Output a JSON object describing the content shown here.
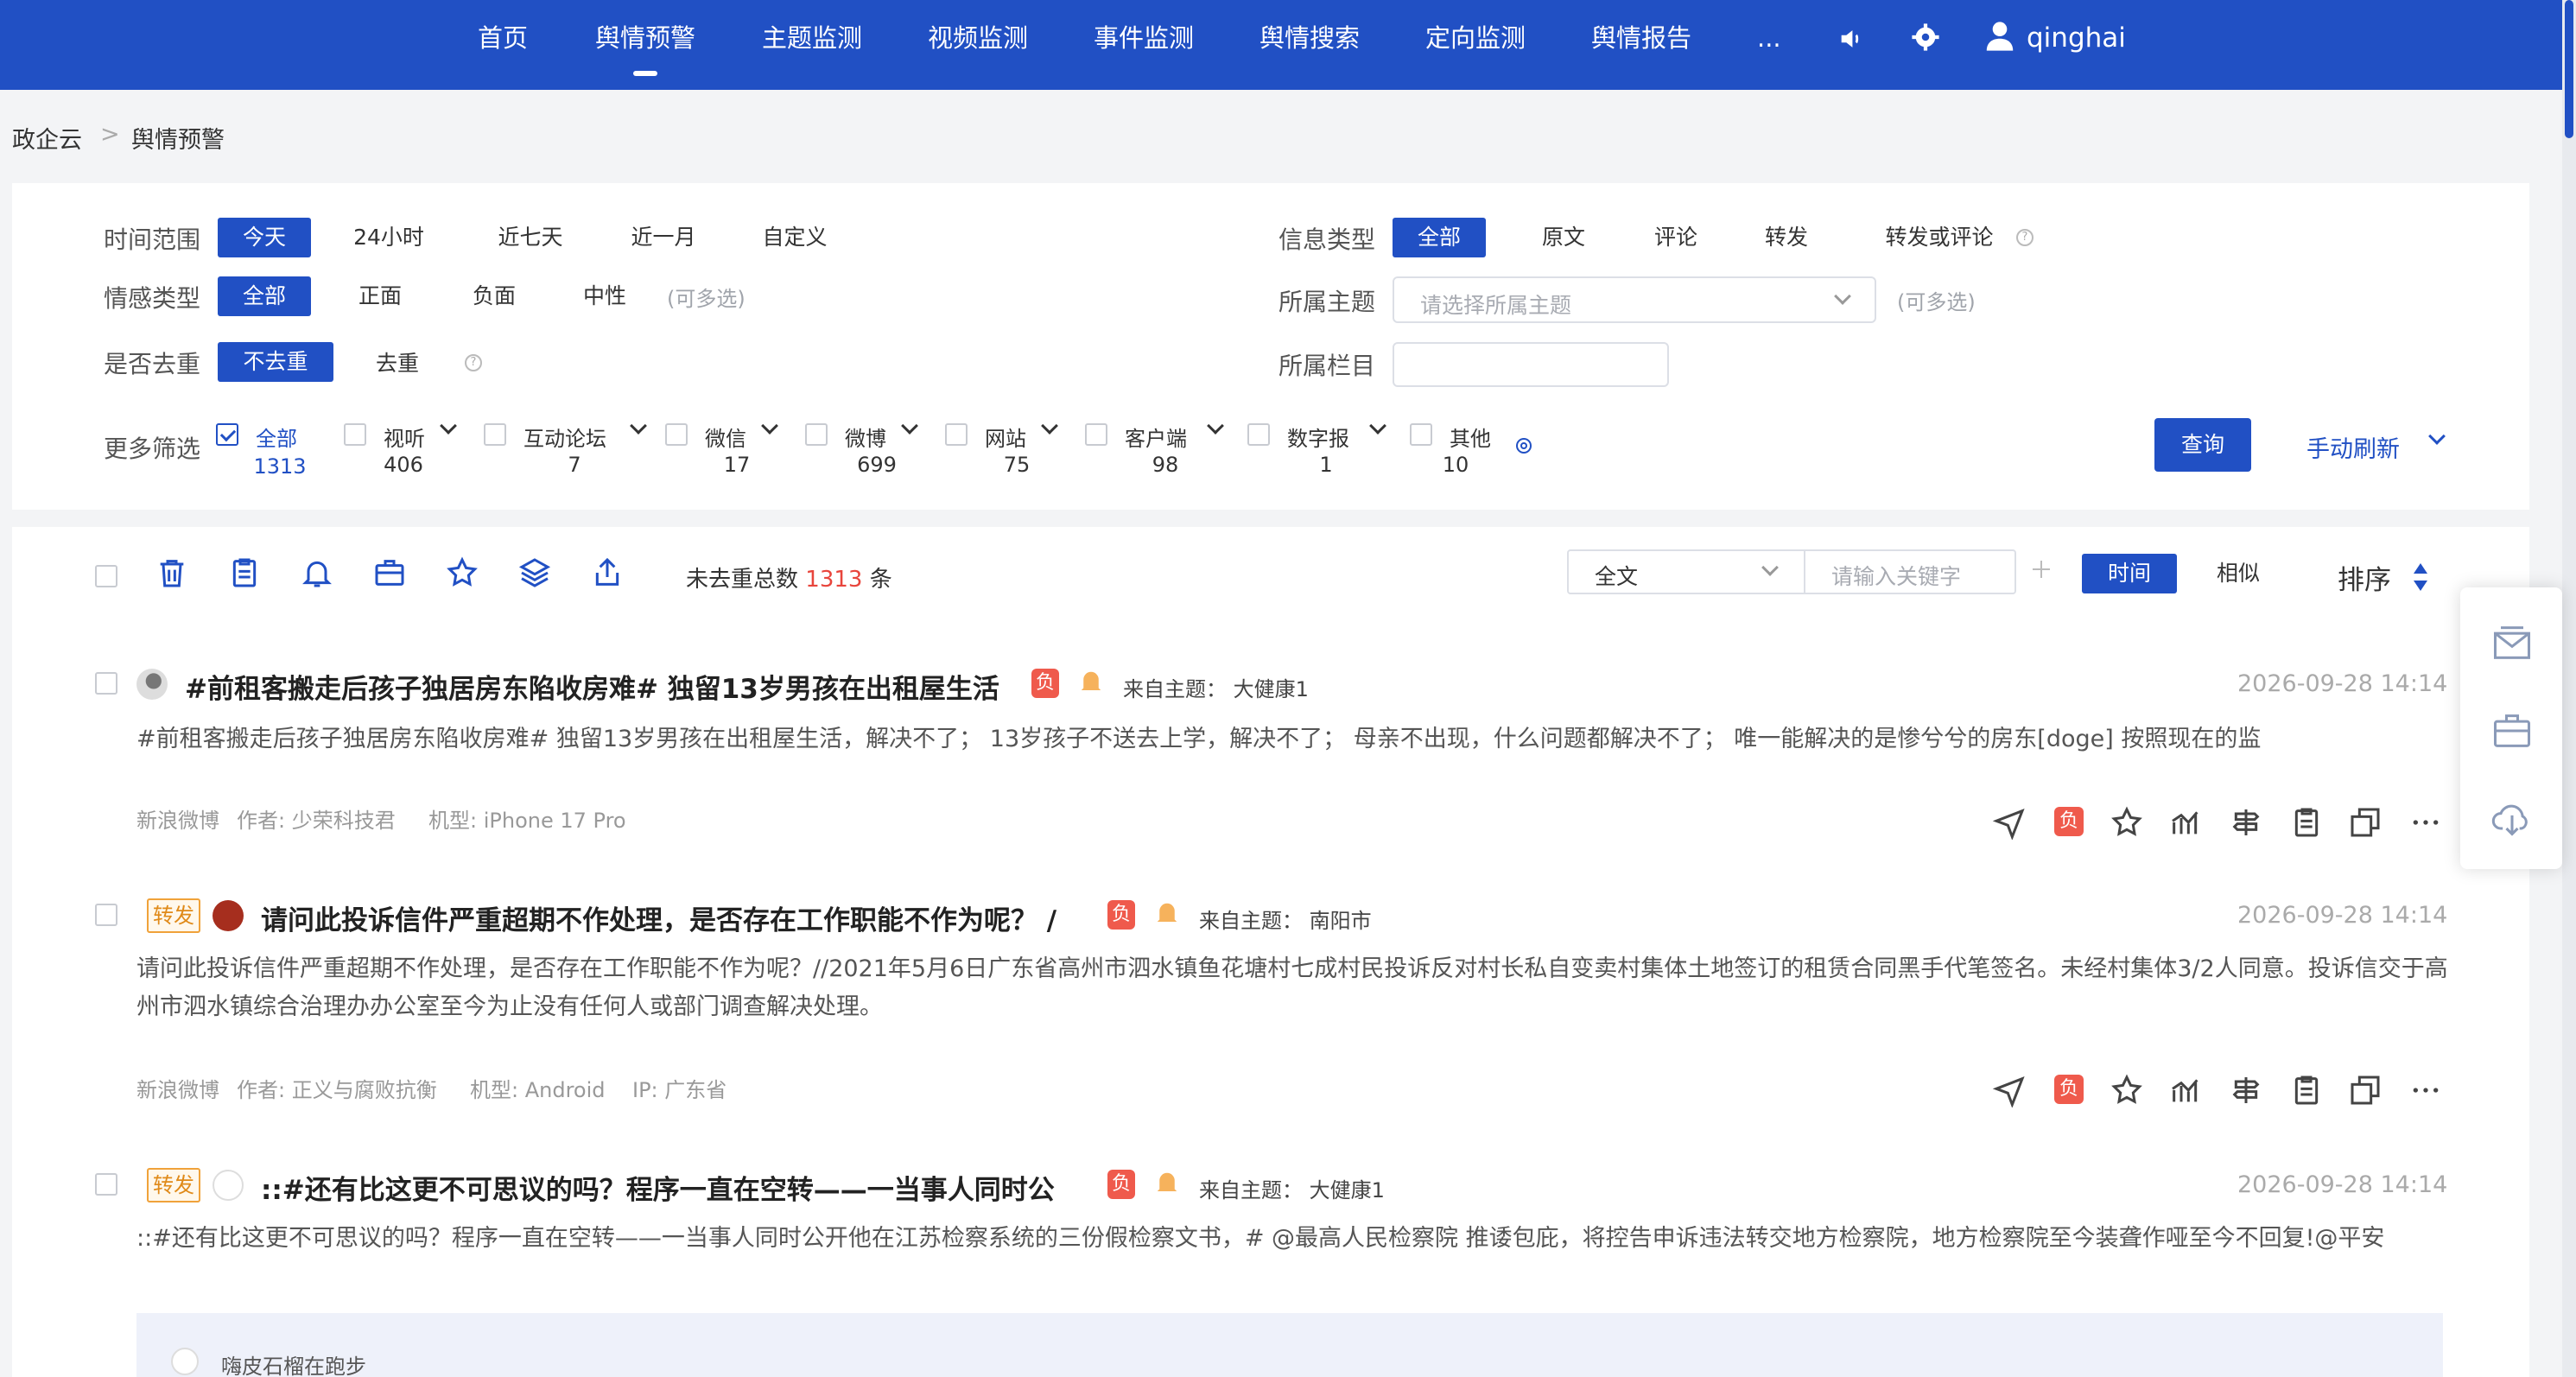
{
  "nav": {
    "items": [
      "首页",
      "舆情预警",
      "主题监测",
      "视频监测",
      "事件监测",
      "舆情搜索",
      "定向监测",
      "舆情报告",
      "..."
    ],
    "active": "舆情预警",
    "user": "qinghai"
  },
  "breadcrumb": {
    "root": "政企云",
    "sep": ">",
    "current": "舆情预警"
  },
  "filters": {
    "time_label": "时间范围",
    "time_opts": [
      "今天",
      "24小时",
      "近七天",
      "近一月",
      "自定义"
    ],
    "sentiment_label": "情感类型",
    "sentiment_opts": [
      "全部",
      "正面",
      "负面",
      "中性"
    ],
    "multi_hint": "(可多选)",
    "dedup_label": "是否去重",
    "dedup_opts": [
      "不去重",
      "去重"
    ],
    "info_label": "信息类型",
    "info_opts": [
      "全部",
      "原文",
      "评论",
      "转发",
      "转发或评论"
    ],
    "topic_label": "所属主题",
    "topic_placeholder": "请选择所属主题",
    "column_label": "所属栏目",
    "more_label": "更多筛选",
    "sources": [
      {
        "name": "全部",
        "count": "1313"
      },
      {
        "name": "视听",
        "count": "406"
      },
      {
        "name": "互动论坛",
        "count": "7"
      },
      {
        "name": "微信",
        "count": "17"
      },
      {
        "name": "微博",
        "count": "699"
      },
      {
        "name": "网站",
        "count": "75"
      },
      {
        "name": "客户端",
        "count": "98"
      },
      {
        "name": "数字报",
        "count": "1"
      },
      {
        "name": "其他",
        "count": "10"
      }
    ],
    "query_btn": "查询",
    "refresh": "手动刷新"
  },
  "toolbar": {
    "total_prefix": "未去重总数",
    "total": "1313",
    "total_suffix": "条",
    "scope": "全文",
    "keyword_placeholder": "请输入关键字",
    "time_btn": "时间",
    "similar_btn": "相似",
    "sort": "排序"
  },
  "posts": [
    {
      "title": "#前租客搬走后孩子独居房东陷收房难# 独留13岁男孩在出租屋生活",
      "neg": "负",
      "topic_label": "来自主题：",
      "topic": "大健康1",
      "date": "2026-09-28 14:14",
      "body": "#前租客搬走后孩子独居房东陷收房难# 独留13岁男孩在出租屋生活，解决不了； 13岁孩子不送去上学，解决不了； 母亲不出现，什么问题都解决不了； 唯一能解决的是惨兮兮的房东[doge] 按照现在的监",
      "meta": [
        "新浪微博",
        "作者: 少荣科技君",
        "机型: iPhone 17 Pro"
      ]
    },
    {
      "tag": "转发",
      "title": "请问此投诉信件严重超期不作处理，是否存在工作职能不作为呢？ /",
      "neg": "负",
      "topic_label": "来自主题：",
      "topic": "南阳市",
      "date": "2026-09-28 14:14",
      "body": "请问此投诉信件严重超期不作处理，是否存在工作职能不作为呢？//2021年5月6日广东省高州市泗水镇鱼花塘村七成村民投诉反对村长私自变卖村集体土地签订的租赁合同黑手代笔签名。未经村集体3/2人同意。投诉信交于高州市泗水镇综合治理办办公室至今为止没有任何人或部门调查解决处理。",
      "meta": [
        "新浪微博",
        "作者: 正义与腐败抗衡",
        "机型: Android",
        "IP: 广东省"
      ]
    },
    {
      "tag": "转发",
      "title": "::#还有比这更不可思议的吗？程序一直在空转——一当事人同时公",
      "neg": "负",
      "topic_label": "来自主题：",
      "topic": "大健康1",
      "date": "2026-09-28 14:14",
      "body": "::#还有比这更不可思议的吗？程序一直在空转——一当事人同时公开他在江苏检察系统的三份假检察文书，# @最高人民检察院 推诿包庇，将控告申诉违法转交地方检察院，地方检察院至今装聋作哑至今不回复!@平安",
      "quote_author": "嗨皮石榴在跑步"
    }
  ],
  "colors": {
    "brand": "#2150c4",
    "negative": "#ef5a4c",
    "count_red": "#e8453c",
    "repost": "#f0a23a"
  }
}
